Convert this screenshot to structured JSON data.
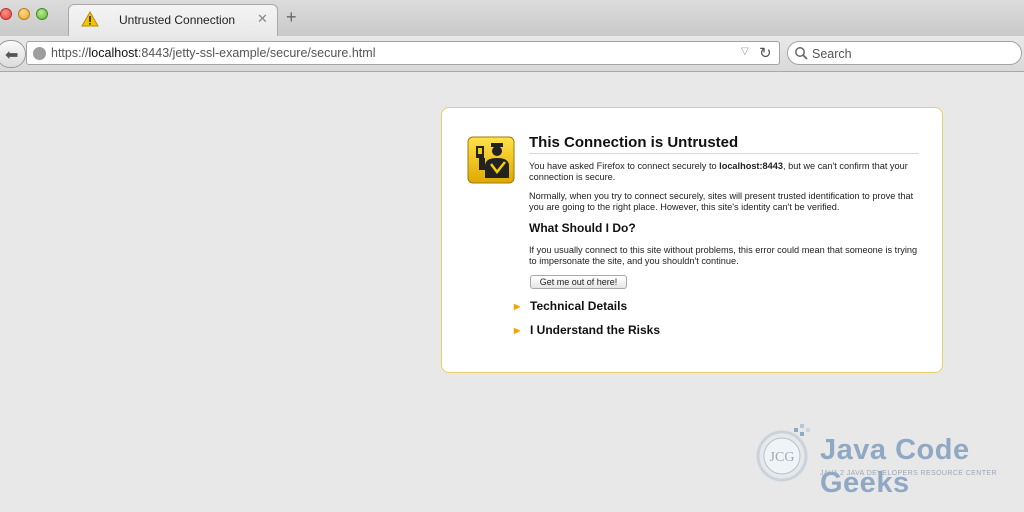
{
  "window": {
    "controls": [
      "close-button",
      "minimize-button",
      "zoom-button"
    ]
  },
  "tab": {
    "title": "Untrusted Connection",
    "close_label": "✕",
    "new_tab_label": "+",
    "icon": "warning-icon"
  },
  "navbar": {
    "back_label": "⬅",
    "url_prefix": "https://",
    "url_host": "localhost",
    "url_rest": ":8443/jetty-ssl-example/secure/secure.html",
    "dropdown_label": "▽",
    "reload_label": "↻",
    "search_placeholder": "Search"
  },
  "error_page": {
    "title": "This Connection is Untrusted",
    "p1_before": "You have asked Firefox to connect securely to ",
    "p1_host": "localhost:8443",
    "p1_after": ", but we can't confirm that your connection is secure.",
    "p2": "Normally, when you try to connect securely, sites will present trusted identification to prove that you are going to the right place. However, this site's identity can't be verified.",
    "subtitle": "What Should I Do?",
    "p3": "If you usually connect to this site without problems, this error could mean that someone is trying to impersonate the site, and you shouldn't continue.",
    "get_out_label": "Get me out of here!",
    "technical_details_label": "Technical Details",
    "understand_risks_label": "I Understand the Risks",
    "expander_arrow": "▶"
  },
  "watermark": {
    "brand": "Java Code Geeks",
    "tagline": "JAVA 2 JAVA DEVELOPERS RESOURCE CENTER"
  },
  "colors": {
    "box_border": "#e8cf6e",
    "icon_yellow": "#f2c200",
    "arrow": "#f0a500"
  }
}
